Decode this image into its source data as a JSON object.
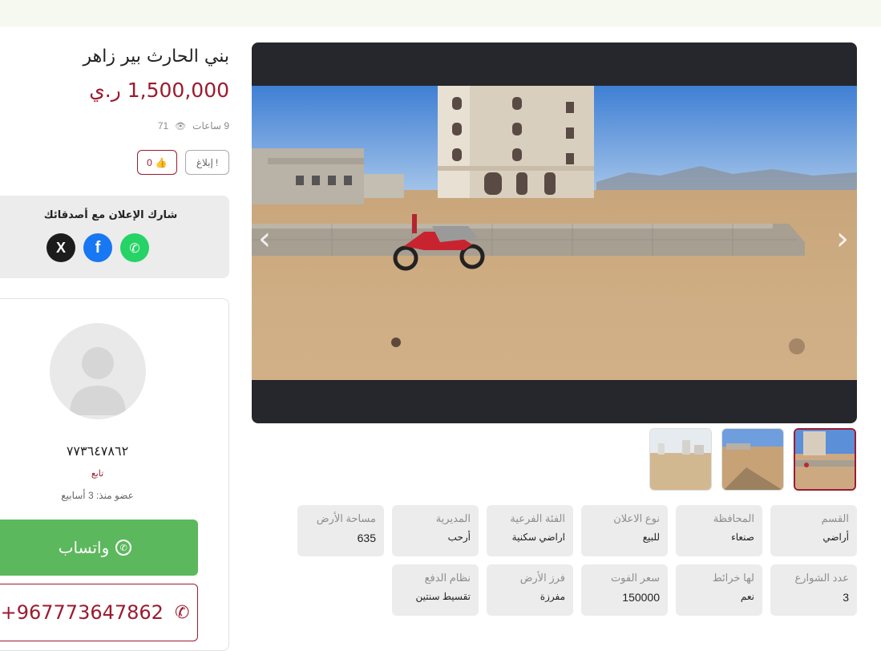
{
  "listing": {
    "title": "بني الحارث بير زاهر",
    "price": "1,500,000 ر.ي",
    "time_ago": "9 ساعات",
    "views": "71",
    "report_label": "إبلاغ",
    "likes": "0"
  },
  "share": {
    "title": "شارك الإعلان مع أصدقائك",
    "networks": [
      "whatsapp",
      "facebook",
      "x"
    ]
  },
  "seller": {
    "name": "٧٧٣٦٤٧٨٦٢",
    "follow_label": "تابع",
    "member_since": "عضو منذ: 3 أسابيع",
    "whatsapp_label": "واتساب",
    "phone": "+967773647862"
  },
  "details": [
    {
      "key": "القسم",
      "value": "أراضي"
    },
    {
      "key": "المحافظة",
      "value": "صنعاء"
    },
    {
      "key": "نوع الاعلان",
      "value": "للبيع"
    },
    {
      "key": "الفئة الفرعية",
      "value": "اراضي سكنية"
    },
    {
      "key": "المديرية",
      "value": "أرحب"
    },
    {
      "key": "مساحة الأرض",
      "value": "635"
    },
    {
      "key": "عدد الشوارع",
      "value": "3"
    },
    {
      "key": "لها خرائط",
      "value": "نعم"
    },
    {
      "key": "سعر الفوت",
      "value": "150000"
    },
    {
      "key": "فرز الأرض",
      "value": "مفرزة"
    },
    {
      "key": "نظام الدفع",
      "value": "تقسيط سنتين"
    }
  ],
  "gallery": {
    "thumb_count": 3,
    "active_index": 0
  },
  "colors": {
    "accent": "#9b1b30",
    "whatsapp": "#5cb85c",
    "facebook": "#1877f2",
    "x": "#1c1c1c",
    "whatsapp_icon": "#25d366"
  }
}
